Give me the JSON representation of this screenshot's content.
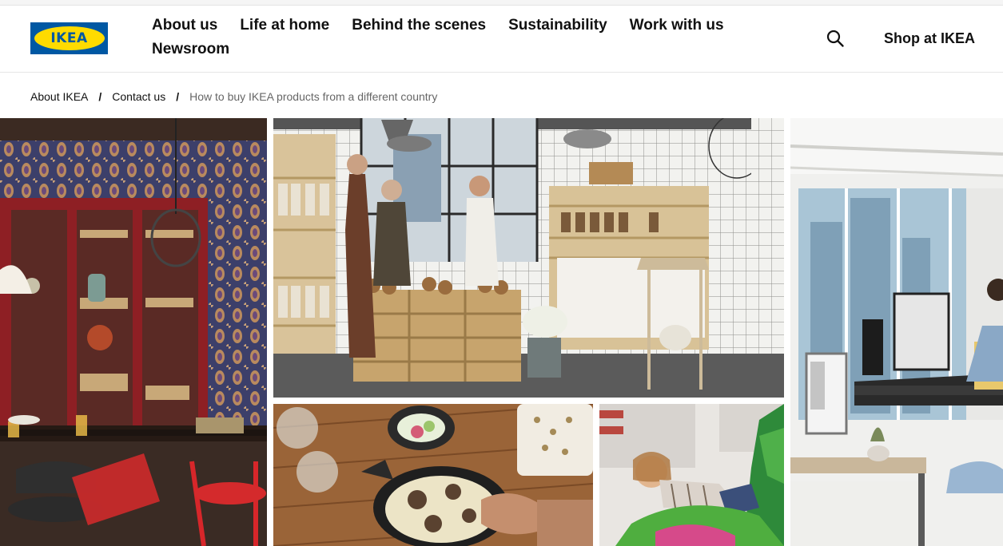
{
  "header": {
    "logo_text": "IKEA",
    "nav_items": [
      {
        "label": "About us"
      },
      {
        "label": "Life at home"
      },
      {
        "label": "Behind the scenes"
      },
      {
        "label": "Sustainability"
      },
      {
        "label": "Work with us"
      },
      {
        "label": "Newsroom"
      }
    ],
    "search_icon": "search-icon",
    "shop_label": "Shop at IKEA"
  },
  "breadcrumb": {
    "items": [
      {
        "label": "About IKEA"
      },
      {
        "label": "Contact us"
      }
    ],
    "separator": "/",
    "current": "How to buy IKEA products from a different country"
  },
  "colors": {
    "ikea_blue": "#0058a3",
    "ikea_yellow": "#ffdb00"
  },
  "gallery": [
    {
      "scene": "dining room with red glass-door cabinets and patterned wallpaper"
    },
    {
      "scene": "grocery store interior with wooden crates and shelves"
    },
    {
      "scene": "table with mushroom dish in black pan"
    },
    {
      "scene": "child playing in store with green fabric"
    },
    {
      "scene": "office with standing desks and monitors"
    }
  ]
}
